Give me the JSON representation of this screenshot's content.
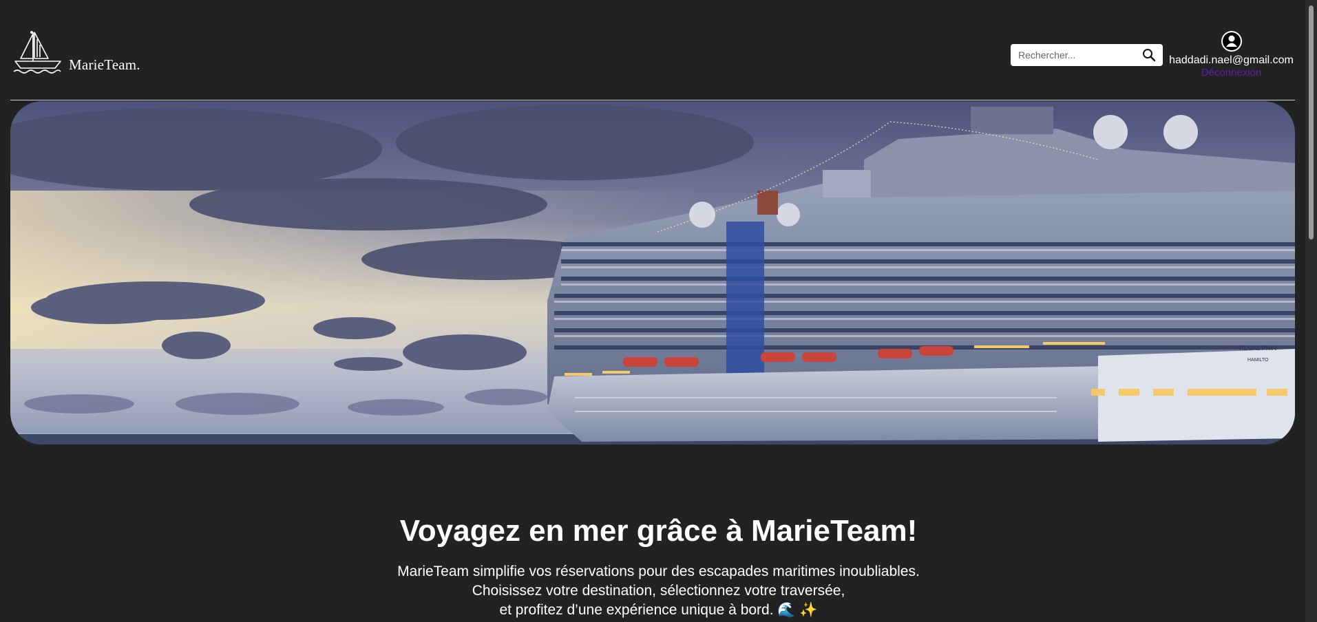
{
  "header": {
    "logo_text": "MarieTeam.",
    "search": {
      "placeholder": "Rechercher..."
    },
    "user": {
      "email": "haddadi.nael@gmail.com",
      "logout_label": "Déconnexion"
    }
  },
  "hero": {
    "ship_name": "REGAL PRIN",
    "ship_port": "HAMILTO"
  },
  "intro": {
    "title": "Voyagez en mer grâce à MarieTeam!",
    "lines": [
      "MarieTeam simplifie vos réservations pour des escapades maritimes inoubliables.",
      "Choisissez votre destination, sélectionnez votre traversée,",
      "et profitez d’une expérience unique à bord. 🌊 ✨"
    ]
  },
  "colors": {
    "background": "#222222",
    "text": "#ffffff",
    "logout_link": "#5a1fa8",
    "divider": "#cfcfcf"
  },
  "icons": {
    "logo": "sailboat-icon",
    "search": "magnifier-icon",
    "avatar": "user-avatar-icon"
  }
}
